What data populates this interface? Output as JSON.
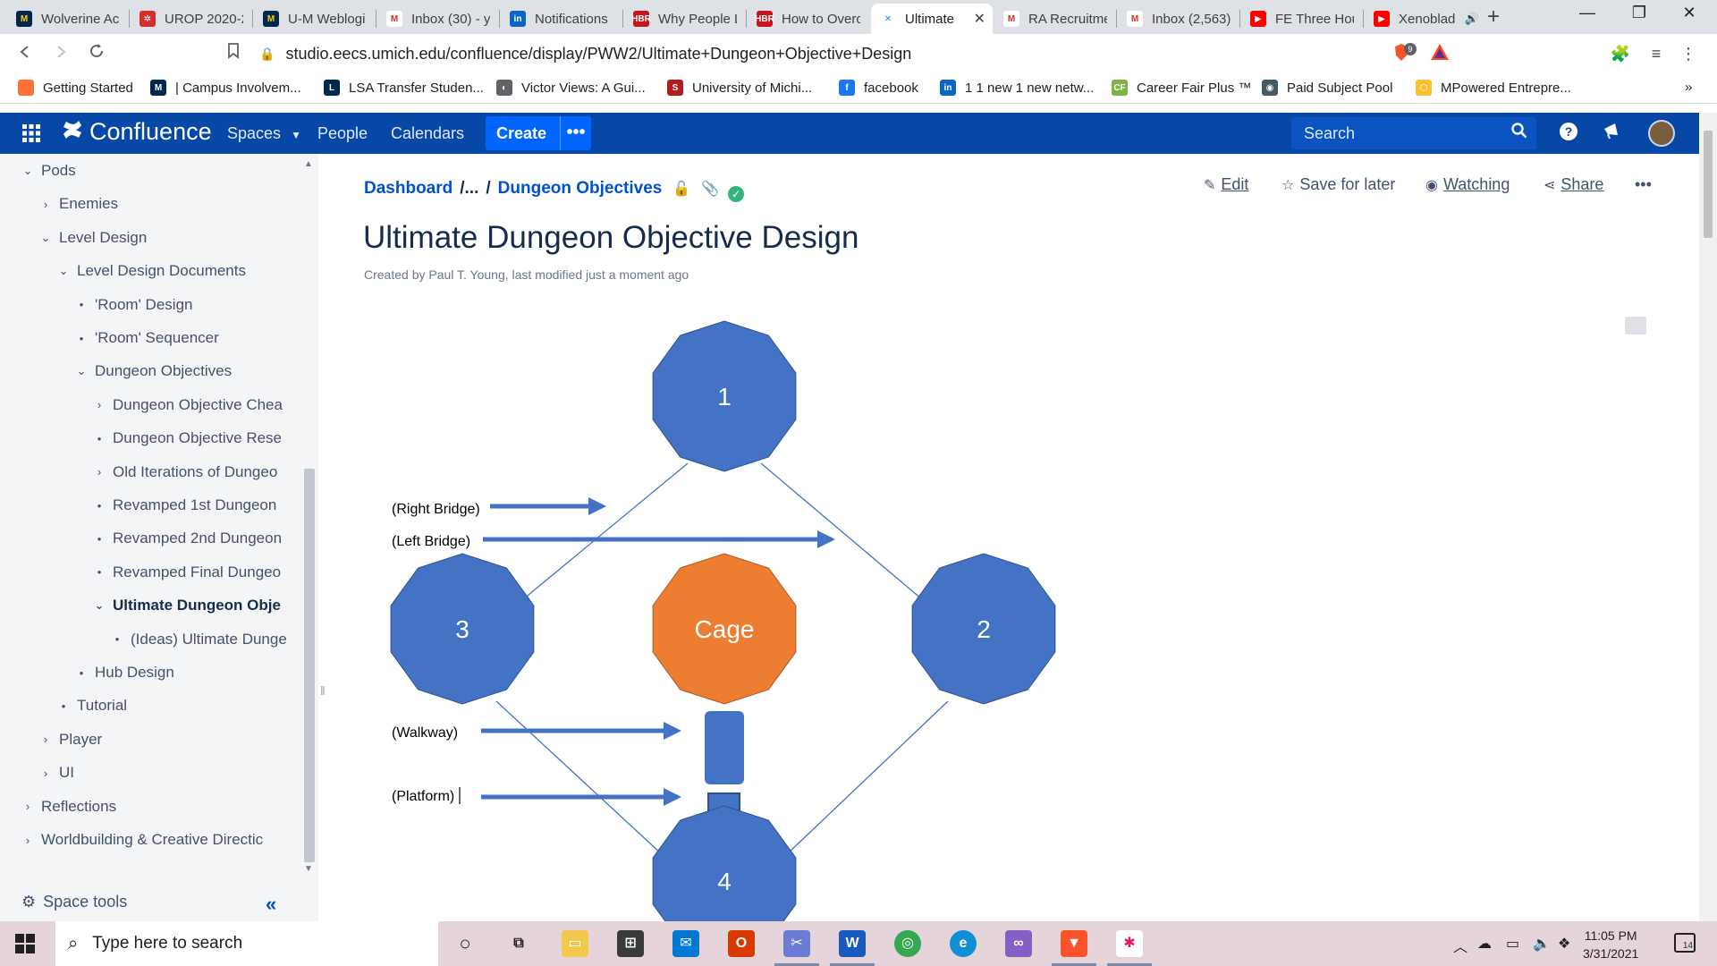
{
  "browser": {
    "tabs": [
      {
        "label": "Wolverine Ac",
        "fav_color": "#00274c",
        "fav_text": "M",
        "fav_fg": "#ffcb05"
      },
      {
        "label": "UROP 2020-2",
        "fav_color": "#d32f2f",
        "fav_text": "✲",
        "fav_fg": "#ffffff"
      },
      {
        "label": "U-M Weblogi",
        "fav_color": "#00274c",
        "fav_text": "M",
        "fav_fg": "#ffcb05"
      },
      {
        "label": "Inbox (30) - y",
        "fav_color": "#ffffff",
        "fav_text": "M",
        "fav_fg": "#d93025"
      },
      {
        "label": "Notifications",
        "fav_color": "#0a66c2",
        "fav_text": "in",
        "fav_fg": "#ffffff"
      },
      {
        "label": "Why People L",
        "fav_color": "#c4161c",
        "fav_text": "HBR",
        "fav_fg": "#ffffff"
      },
      {
        "label": "How to Overc",
        "fav_color": "#c4161c",
        "fav_text": "HBR",
        "fav_fg": "#ffffff"
      },
      {
        "label": "Ultimate",
        "fav_color": "#ffffff",
        "fav_text": "✕",
        "fav_fg": "#2684ff",
        "active": true
      },
      {
        "label": "RA Recruitme",
        "fav_color": "#ffffff",
        "fav_text": "M",
        "fav_fg": "#d93025"
      },
      {
        "label": "Inbox (2,563)",
        "fav_color": "#ffffff",
        "fav_text": "M",
        "fav_fg": "#d93025"
      },
      {
        "label": "FE Three Hou",
        "fav_color": "#ff0000",
        "fav_text": "▶",
        "fav_fg": "#ffffff"
      },
      {
        "label": "Xenoblad",
        "fav_color": "#ff0000",
        "fav_text": "▶",
        "fav_fg": "#ffffff",
        "audio": "🔊"
      }
    ],
    "new_tab": "+",
    "window_controls": {
      "minimize": "—",
      "restore": "❐",
      "close": "✕"
    },
    "url": "studio.eecs.umich.edu/confluence/display/PWW2/Ultimate+Dungeon+Objective+Design",
    "brave_badge": "9",
    "bookmarks": [
      {
        "label": "Getting Started",
        "fav_color": "#ff7139",
        "fav_text": ""
      },
      {
        "label": "| Campus Involvem...",
        "fav_color": "#00274c",
        "fav_text": "M"
      },
      {
        "label": "LSA Transfer Studen...",
        "fav_color": "#00274c",
        "fav_text": "L"
      },
      {
        "label": "Victor Views: A Gui...",
        "fav_color": "#5f6368",
        "fav_text": "◐"
      },
      {
        "label": "University of Michi...",
        "fav_color": "#b71c1c",
        "fav_text": "S"
      },
      {
        "label": "facebook",
        "fav_color": "#1877f2",
        "fav_text": "f"
      },
      {
        "label": "1 1 new 1 new netw...",
        "fav_color": "#0a66c2",
        "fav_text": "in"
      },
      {
        "label": "Career Fair Plus ™",
        "fav_color": "#7cb342",
        "fav_text": "CF"
      },
      {
        "label": "Paid Subject Pool",
        "fav_color": "#455a64",
        "fav_text": "◉"
      },
      {
        "label": "MPowered Entrepre...",
        "fav_color": "#fbc02d",
        "fav_text": "⬡"
      }
    ],
    "bookmarks_more": "»"
  },
  "confluence": {
    "brand": "Confluence",
    "nav": {
      "spaces": "Spaces",
      "people": "People",
      "calendars": "Calendars"
    },
    "create": "Create",
    "create_more": "•••",
    "search_placeholder": "Search"
  },
  "sidebar": {
    "items": [
      {
        "label": "Pods",
        "icon": "⌄",
        "level": 0
      },
      {
        "label": "Enemies",
        "icon": "›",
        "level": 1
      },
      {
        "label": "Level Design",
        "icon": "⌄",
        "level": 1
      },
      {
        "label": "Level Design Documents",
        "icon": "⌄",
        "level": 2
      },
      {
        "label": "'Room' Design",
        "icon": "•",
        "level": 3
      },
      {
        "label": "'Room' Sequencer",
        "icon": "•",
        "level": 3
      },
      {
        "label": "Dungeon Objectives",
        "icon": "⌄",
        "level": 3
      },
      {
        "label": "Dungeon Objective Chea",
        "icon": "›",
        "level": 4
      },
      {
        "label": "Dungeon Objective Rese",
        "icon": "•",
        "level": 4
      },
      {
        "label": "Old Iterations of Dungeo",
        "icon": "›",
        "level": 4
      },
      {
        "label": "Revamped 1st Dungeon",
        "icon": "•",
        "level": 4
      },
      {
        "label": "Revamped 2nd Dungeon",
        "icon": "•",
        "level": 4
      },
      {
        "label": "Revamped Final Dungeo",
        "icon": "•",
        "level": 4
      },
      {
        "label": "Ultimate Dungeon Obje",
        "icon": "⌄",
        "level": 4,
        "current": true
      },
      {
        "label": "(Ideas) Ultimate Dunge",
        "icon": "•",
        "level": 5
      },
      {
        "label": "Hub Design",
        "icon": "•",
        "level": 3
      },
      {
        "label": "Tutorial",
        "icon": "•",
        "level": 2
      },
      {
        "label": "Player",
        "icon": "›",
        "level": 1
      },
      {
        "label": "UI",
        "icon": "›",
        "level": 1
      },
      {
        "label": "Reflections",
        "icon": "›",
        "level": 0
      },
      {
        "label": "Worldbuilding & Creative Directic",
        "icon": "›",
        "level": 0
      }
    ],
    "space_tools": "Space tools",
    "collapse": "«"
  },
  "page": {
    "breadcrumb": {
      "root": "Dashboard",
      "ellipsis": "/...",
      "sep": "/",
      "parent": "Dungeon Objectives"
    },
    "actions": {
      "edit": "Edit",
      "save": "Save for later",
      "watching": "Watching",
      "share": "Share",
      "more": "•••"
    },
    "title": "Ultimate Dungeon Objective Design",
    "byline": "Created by Paul T. Young, last modified just a moment ago"
  },
  "diagram": {
    "colors": {
      "room": "#4472c4",
      "cage": "#ed7d31",
      "line": "#4472c4",
      "text": "#ffffff"
    },
    "nodes": [
      {
        "id": "room-1",
        "label": "1",
        "kind": "room"
      },
      {
        "id": "room-2",
        "label": "2",
        "kind": "room"
      },
      {
        "id": "room-3",
        "label": "3",
        "kind": "room"
      },
      {
        "id": "room-4",
        "label": "4",
        "kind": "room"
      },
      {
        "id": "cage",
        "label": "Cage",
        "kind": "cage"
      }
    ],
    "labels": {
      "right_bridge": "(Right Bridge)",
      "left_bridge": "(Left Bridge)",
      "walkway": "(Walkway)",
      "platform": "(Platform)"
    }
  },
  "taskbar": {
    "search_placeholder": "Type here to search",
    "time": "11:05 PM",
    "date": "3/31/2021",
    "notifications": "14"
  }
}
